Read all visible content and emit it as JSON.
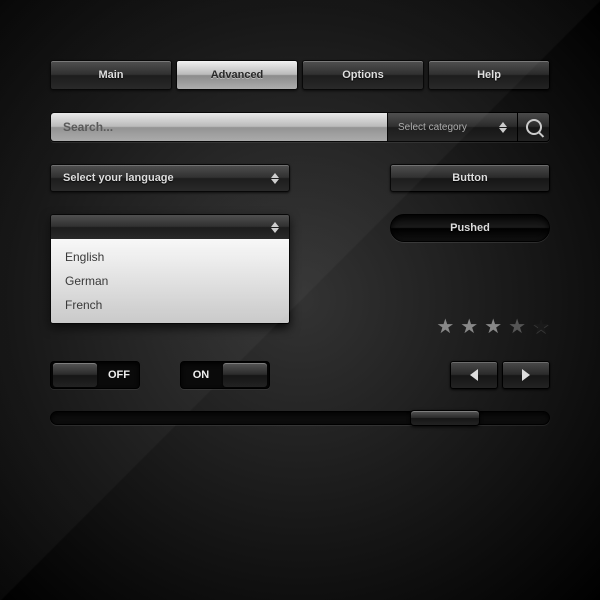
{
  "tabs": [
    {
      "label": "Main"
    },
    {
      "label": "Advanced"
    },
    {
      "label": "Options"
    },
    {
      "label": "Help"
    }
  ],
  "active_tab": 1,
  "search": {
    "placeholder": "Search...",
    "category_label": "Select category"
  },
  "language_select": {
    "label": "Select your language"
  },
  "button": {
    "label": "Button"
  },
  "pushed": {
    "label": "Pushed"
  },
  "dropdown": {
    "items": [
      "English",
      "German",
      "French"
    ]
  },
  "stars": {
    "rating": 3,
    "max": 5
  },
  "toggle_off": {
    "label": "OFF"
  },
  "toggle_on": {
    "label": "ON"
  },
  "scrollbar": {
    "position": 0.72
  }
}
